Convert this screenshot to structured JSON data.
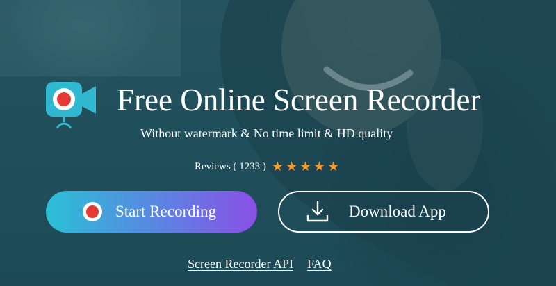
{
  "hero": {
    "title": "Free Online Screen Recorder",
    "subtitle": "Without watermark & No time limit & HD quality",
    "logo_icon": "webcam-record-icon",
    "reviews": {
      "label": "Reviews ( 1233 )",
      "rating": 5,
      "max_rating": 5,
      "star_icon": "star-icon",
      "star_color": "#f39a2b"
    },
    "buttons": {
      "start_label": "Start Recording",
      "start_icon": "record-icon",
      "download_label": "Download App",
      "download_icon": "download-icon"
    },
    "links": {
      "api_label": "Screen Recorder API",
      "faq_label": "FAQ"
    }
  },
  "colors": {
    "background": "#24505c",
    "accent_cyan": "#2ac0d6",
    "accent_purple": "#8a4fe6",
    "record_red": "#e53935",
    "logo_teal": "#2fb8cf"
  }
}
